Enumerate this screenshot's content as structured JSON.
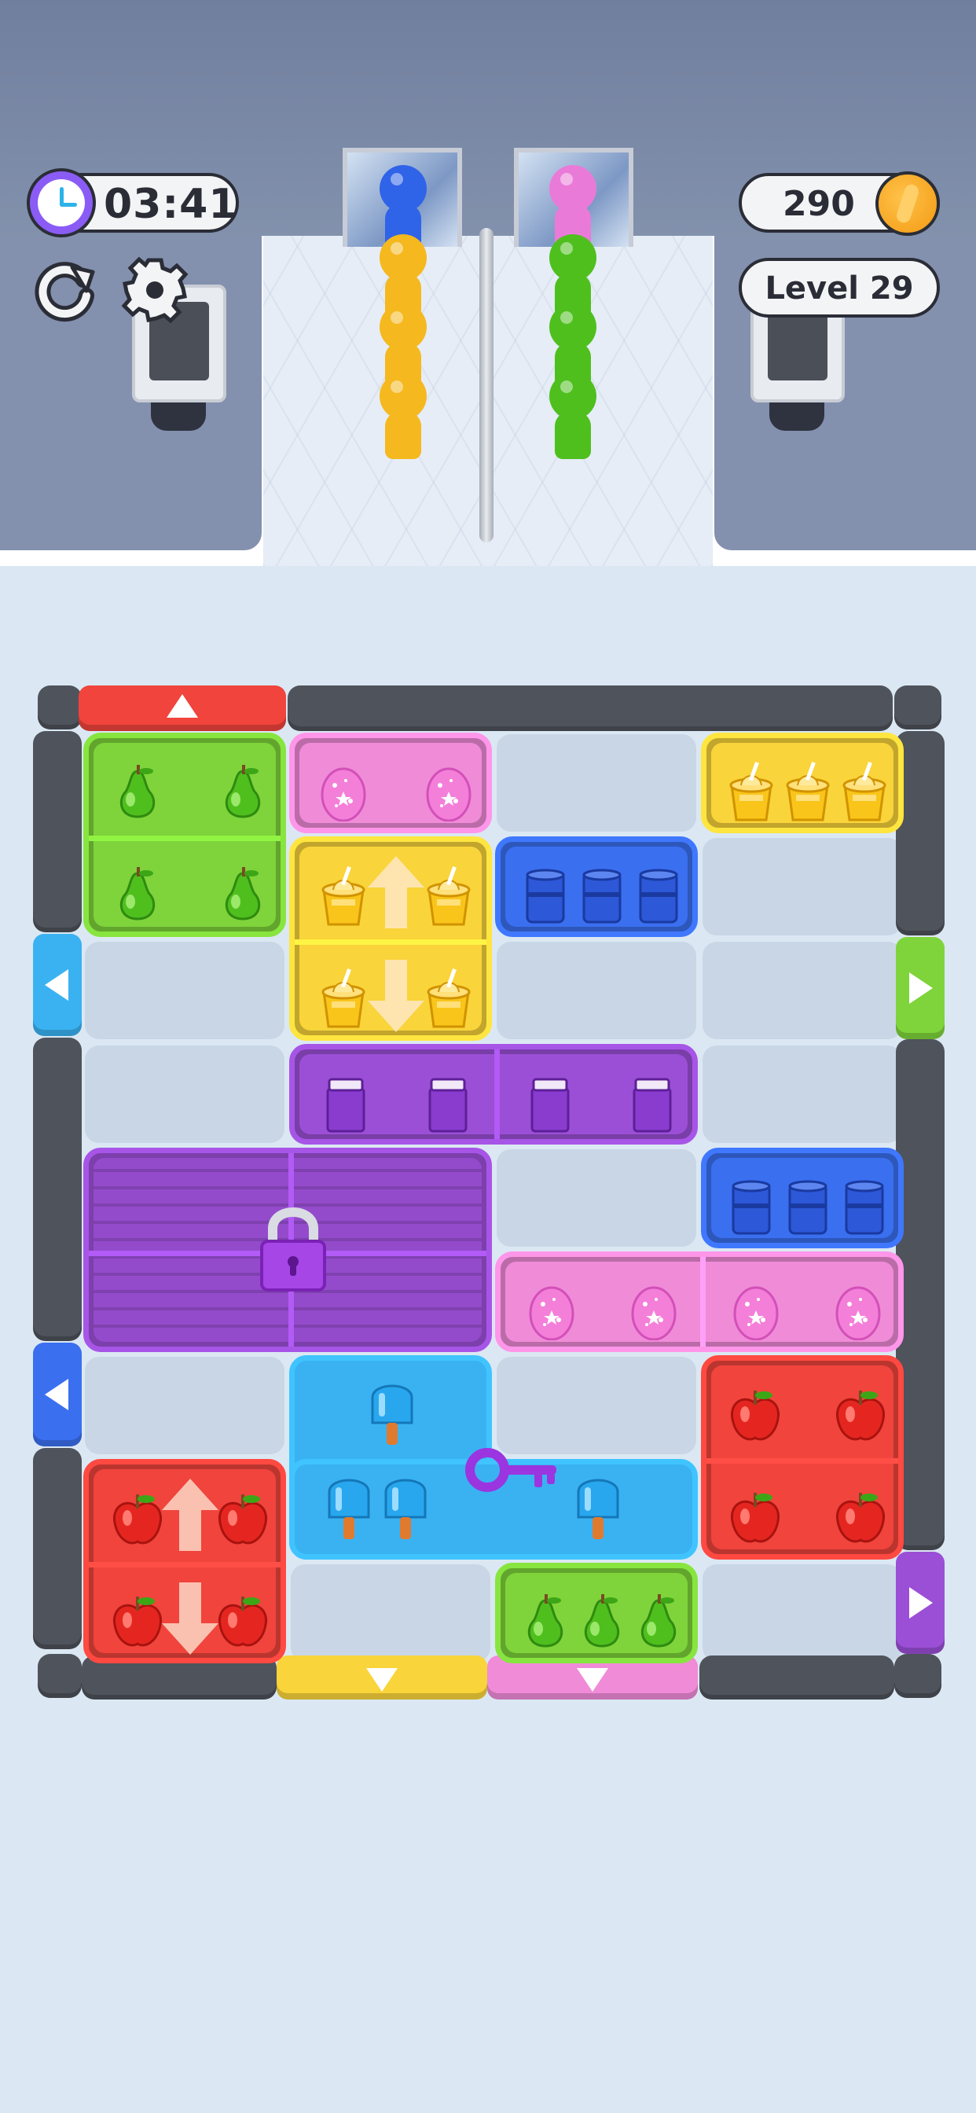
{
  "hud": {
    "timer": "03:41",
    "coins": "290",
    "level": "Level 29"
  },
  "icons": {
    "timer": "clock-icon",
    "coins": "coin-icon",
    "restart": "restart-icon",
    "settings": "gear-icon",
    "lock": "padlock-icon",
    "key": "key-icon"
  },
  "queues": [
    {
      "lane": "left",
      "colors": [
        "#2f63e8",
        "#f5b81e",
        "#f5b81e",
        "#f5b81e"
      ]
    },
    {
      "lane": "right",
      "colors": [
        "#ea7ad8",
        "#4fbf1e",
        "#4fbf1e",
        "#4fbf1e"
      ]
    }
  ],
  "colors": {
    "green": "#7ed43a",
    "pink": "#f08bd8",
    "yellow": "#f9d43a",
    "blue": "#3a6ff0",
    "purple": "#9b4fd6",
    "cyan": "#3ab2f2",
    "red": "#f0443c"
  },
  "exits": [
    {
      "id": "exit-top-red",
      "side": "top",
      "color": "red",
      "direction": "up"
    },
    {
      "id": "exit-left-cyan",
      "side": "left",
      "color": "cyan",
      "direction": "left"
    },
    {
      "id": "exit-right-green",
      "side": "right",
      "color": "green",
      "direction": "right"
    },
    {
      "id": "exit-left-blue",
      "side": "left",
      "color": "blue",
      "direction": "left"
    },
    {
      "id": "exit-right-purple",
      "side": "right",
      "color": "purple",
      "direction": "right"
    },
    {
      "id": "exit-bottom-yellow",
      "side": "bottom",
      "color": "yellow",
      "direction": "down"
    },
    {
      "id": "exit-bottom-pink",
      "side": "bottom",
      "color": "pink",
      "direction": "down"
    }
  ],
  "blocks": [
    {
      "id": "green-pears-2x2",
      "color": "green",
      "item": "pear",
      "count": 4
    },
    {
      "id": "pink-eggs-top",
      "color": "pink",
      "item": "egg",
      "count": 2
    },
    {
      "id": "yellow-cups-top",
      "color": "yellow",
      "item": "cup",
      "count": 3
    },
    {
      "id": "yellow-cups-vertical",
      "color": "yellow",
      "item": "cup",
      "count": 4,
      "movement": "vertical"
    },
    {
      "id": "blue-cans-top",
      "color": "blue",
      "item": "can",
      "count": 3
    },
    {
      "id": "purple-jars-row",
      "color": "purple",
      "item": "jar",
      "count": 4
    },
    {
      "id": "purple-locked",
      "color": "purple",
      "item": "locked",
      "locked": true
    },
    {
      "id": "blue-cans-mid",
      "color": "blue",
      "item": "can",
      "count": 3
    },
    {
      "id": "pink-eggs-row",
      "color": "pink",
      "item": "egg",
      "count": 4
    },
    {
      "id": "cyan-popsicles",
      "color": "cyan",
      "item": "popsicle",
      "count": 4,
      "has_key": true
    },
    {
      "id": "red-apples-right",
      "color": "red",
      "item": "apple",
      "count": 4
    },
    {
      "id": "red-apples-vertical",
      "color": "red",
      "item": "apple",
      "count": 4,
      "movement": "vertical"
    },
    {
      "id": "green-pears-bottom",
      "color": "green",
      "item": "pear",
      "count": 3
    }
  ]
}
